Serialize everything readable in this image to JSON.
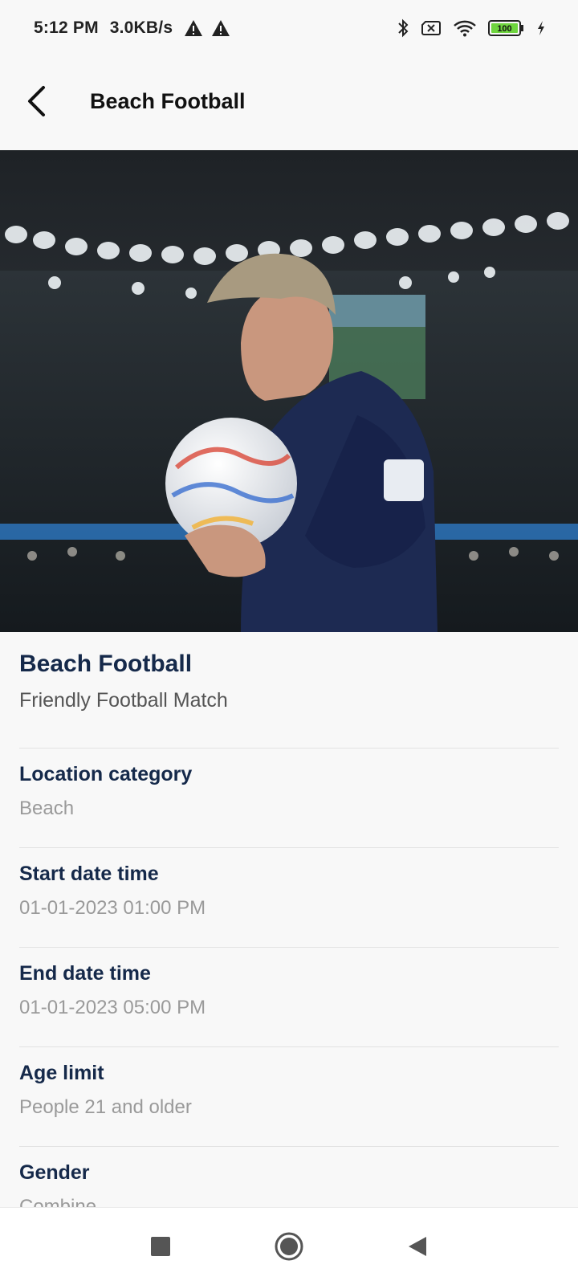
{
  "status_bar": {
    "time": "5:12 PM",
    "speed": "3.0KB/s",
    "battery": "100",
    "icons": [
      "warning-icon",
      "warning-icon",
      "bluetooth-icon",
      "no-sim-icon",
      "wifi-icon",
      "battery-icon",
      "charging-icon"
    ]
  },
  "app_bar": {
    "title": "Beach Football",
    "back_icon": "chevron-left-icon"
  },
  "event": {
    "title": "Beach Football",
    "subtitle": "Friendly Football Match"
  },
  "details": [
    {
      "label": "Location category",
      "value": "Beach"
    },
    {
      "label": "Start date time",
      "value": "01-01-2023 01:00 PM"
    },
    {
      "label": "End date time",
      "value": "01-01-2023 05:00 PM"
    },
    {
      "label": "Age limit",
      "value": "People 21 and older"
    },
    {
      "label": "Gender",
      "value": "Combine"
    }
  ],
  "nav_bar": {
    "icons": [
      "recents-icon",
      "home-icon",
      "back-triangle-icon"
    ]
  },
  "colors": {
    "heading": "#15294a",
    "muted": "#9a9a9a",
    "background": "#f8f8f8",
    "battery_fill": "#6fd53f"
  }
}
